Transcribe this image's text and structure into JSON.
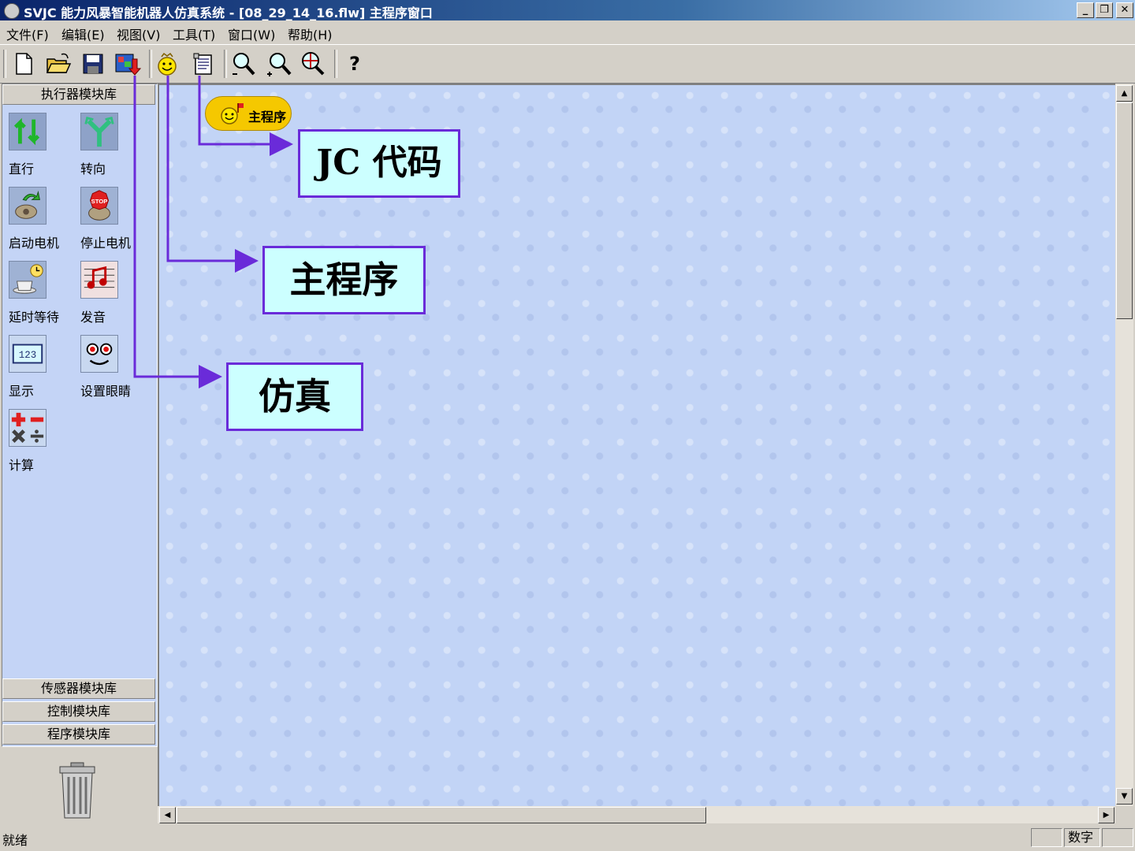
{
  "window": {
    "title": "SVJC 能力风暴智能机器人仿真系统 - [08_29_14_16.flw]   主程序窗口",
    "minimize": "_",
    "restore": "❐",
    "close": "✕"
  },
  "menu": [
    "文件(F)",
    "编辑(E)",
    "视图(V)",
    "工具(T)",
    "窗口(W)",
    "帮助(H)"
  ],
  "toolbar": {
    "icons": [
      "new-file-icon",
      "open-folder-icon",
      "save-disk-icon",
      "simulate-download-icon",
      "main-program-smiley-icon",
      "jc-code-icon",
      "zoom-out-icon",
      "zoom-in-icon",
      "zoom-fit-icon",
      "help-icon"
    ],
    "help_glyph": "?"
  },
  "left_panel": {
    "actuator_library": "执行器模块库",
    "modules": [
      {
        "label": "直行",
        "icon": "straight-icon"
      },
      {
        "label": "转向",
        "icon": "turn-icon"
      },
      {
        "label": "启动电机",
        "icon": "start-motor-icon"
      },
      {
        "label": "停止电机",
        "icon": "stop-motor-icon"
      },
      {
        "label": "延时等待",
        "icon": "delay-wait-icon"
      },
      {
        "label": "发音",
        "icon": "sound-icon"
      },
      {
        "label": "显示",
        "icon": "display-icon"
      },
      {
        "label": "设置眼睛",
        "icon": "set-eyes-icon"
      },
      {
        "label": "计算",
        "icon": "calculate-icon"
      }
    ],
    "display_value": "123",
    "stop_text": "STOP",
    "sensor_library": "传感器模块库",
    "control_library": "控制模块库",
    "program_library": "程序模块库"
  },
  "canvas": {
    "main_node_label": "主程序"
  },
  "annotations": {
    "jc_code": "JC 代码",
    "main_program": "主程序",
    "simulation": "仿真"
  },
  "status": {
    "text": "就绪",
    "pane_numlock": "数字"
  },
  "colors": {
    "annotation_border": "#6a2bd9",
    "annotation_fill": "#ccffff",
    "canvas": "#c2d4f6",
    "node": "#f5c800"
  }
}
